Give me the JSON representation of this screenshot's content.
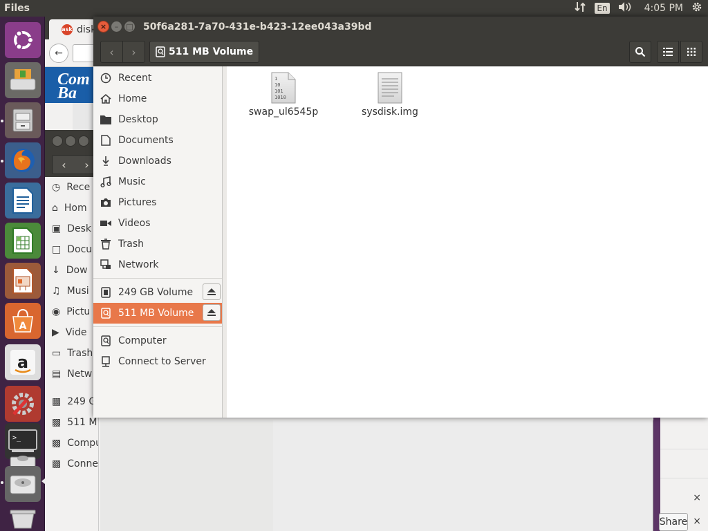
{
  "top_panel": {
    "app_title": "Files",
    "keyboard_layout": "En",
    "clock": "4:05 PM"
  },
  "launcher": {
    "items": [
      {
        "name": "Ubuntu Dash",
        "icon": "ubuntu-logo-icon"
      },
      {
        "name": "Disk Usage / Files",
        "icon": "hard-disk-icon"
      },
      {
        "name": "Files",
        "icon": "file-cabinet-icon"
      },
      {
        "name": "Firefox",
        "icon": "firefox-icon"
      },
      {
        "name": "LibreOffice Writer",
        "icon": "writer-icon"
      },
      {
        "name": "LibreOffice Calc",
        "icon": "calc-icon"
      },
      {
        "name": "LibreOffice Impress",
        "icon": "impress-icon"
      },
      {
        "name": "Ubuntu Software",
        "icon": "software-center-icon"
      },
      {
        "name": "Amazon",
        "icon": "amazon-icon"
      },
      {
        "name": "System Settings",
        "icon": "settings-icon"
      },
      {
        "name": "Terminal",
        "icon": "terminal-icon"
      },
      {
        "name": "Drive",
        "icon": "drive-icon"
      },
      {
        "name": "Trash",
        "icon": "trash-icon"
      }
    ]
  },
  "bg_browser": {
    "tab_label": "disk",
    "tab_favicon": "ask",
    "banner_text": "Com\nBa"
  },
  "bg_files": {
    "sidebar_items": [
      "Rece",
      "Hom",
      "Desk",
      "Docu",
      "Dow",
      "Musi",
      "Pictu",
      "Vide",
      "Trash",
      "Netw",
      "249 G",
      "511 M",
      "Compu",
      "Conne"
    ]
  },
  "bg_right": {
    "share_label": "Share",
    "close_glyph": "×"
  },
  "window": {
    "title": "50f6a281-7a70-431e-b423-12ee043a39bd",
    "path_label": "511 MB Volume",
    "sidebar": {
      "places": [
        {
          "label": "Recent",
          "icon": "clock-icon"
        },
        {
          "label": "Home",
          "icon": "home-icon"
        },
        {
          "label": "Desktop",
          "icon": "folder-icon"
        },
        {
          "label": "Documents",
          "icon": "document-icon"
        },
        {
          "label": "Downloads",
          "icon": "download-icon"
        },
        {
          "label": "Music",
          "icon": "music-icon"
        },
        {
          "label": "Pictures",
          "icon": "camera-icon"
        },
        {
          "label": "Videos",
          "icon": "video-icon"
        },
        {
          "label": "Trash",
          "icon": "trash-icon"
        },
        {
          "label": "Network",
          "icon": "network-icon"
        }
      ],
      "devices": [
        {
          "label": "249 GB Volume",
          "icon": "drive-icon",
          "selected": false
        },
        {
          "label": "511 MB Volume",
          "icon": "usb-drive-icon",
          "selected": true
        }
      ],
      "other": [
        {
          "label": "Computer",
          "icon": "computer-icon"
        },
        {
          "label": "Connect to Server",
          "icon": "server-icon"
        }
      ]
    },
    "files": [
      {
        "name": "swap_ul6545p",
        "icon": "binary-file-icon",
        "binary_lines": [
          "1",
          "10",
          "101",
          "1010"
        ]
      },
      {
        "name": "sysdisk.img",
        "icon": "text-file-icon"
      }
    ]
  }
}
